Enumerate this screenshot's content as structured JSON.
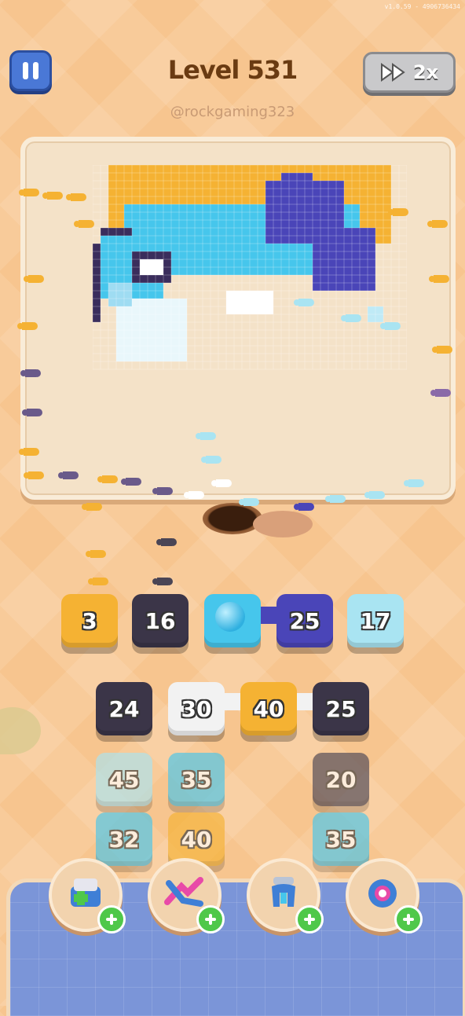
{
  "version_text": "v1.0.59 - 4906736434",
  "header": {
    "level_label": "Level 531",
    "speed_label": "2x"
  },
  "watermark": "@rockgaming323",
  "colors": {
    "yellow": "#f5b233",
    "dark": "#3b3548",
    "cyan": "#46c6ec",
    "purple": "#4a45b8",
    "light_cyan": "#a9e4f2",
    "white": "#f2f2f2",
    "grey": "#4a4555"
  },
  "queue": [
    {
      "value": "3",
      "color": "yellow"
    },
    {
      "value": "16",
      "color": "dark"
    },
    {
      "value": "",
      "color": "cyan"
    },
    {
      "value": "25",
      "color": "purple"
    },
    {
      "value": "17",
      "color": "light_cyan"
    }
  ],
  "grid": [
    {
      "value": "24",
      "color": "dark",
      "faded": false
    },
    {
      "value": "30",
      "color": "white",
      "faded": false
    },
    {
      "value": "40",
      "color": "yellow",
      "faded": false
    },
    {
      "value": "25",
      "color": "dark",
      "faded": false
    },
    {
      "value": "45",
      "color": "light_cyan",
      "faded": true
    },
    {
      "value": "35",
      "color": "cyan",
      "faded": true
    },
    {
      "value": "20",
      "color": "grey",
      "faded": true
    },
    {
      "value": "32",
      "color": "cyan",
      "faded": true
    },
    {
      "value": "40",
      "color": "yellow",
      "faded": true
    },
    {
      "value": "35",
      "color": "cyan",
      "faded": true
    }
  ],
  "boosters": [
    {
      "icon": "add-box-icon"
    },
    {
      "icon": "shuffle-arrows-icon"
    },
    {
      "icon": "magnet-claw-icon"
    },
    {
      "icon": "hole-pipe-icon"
    }
  ]
}
